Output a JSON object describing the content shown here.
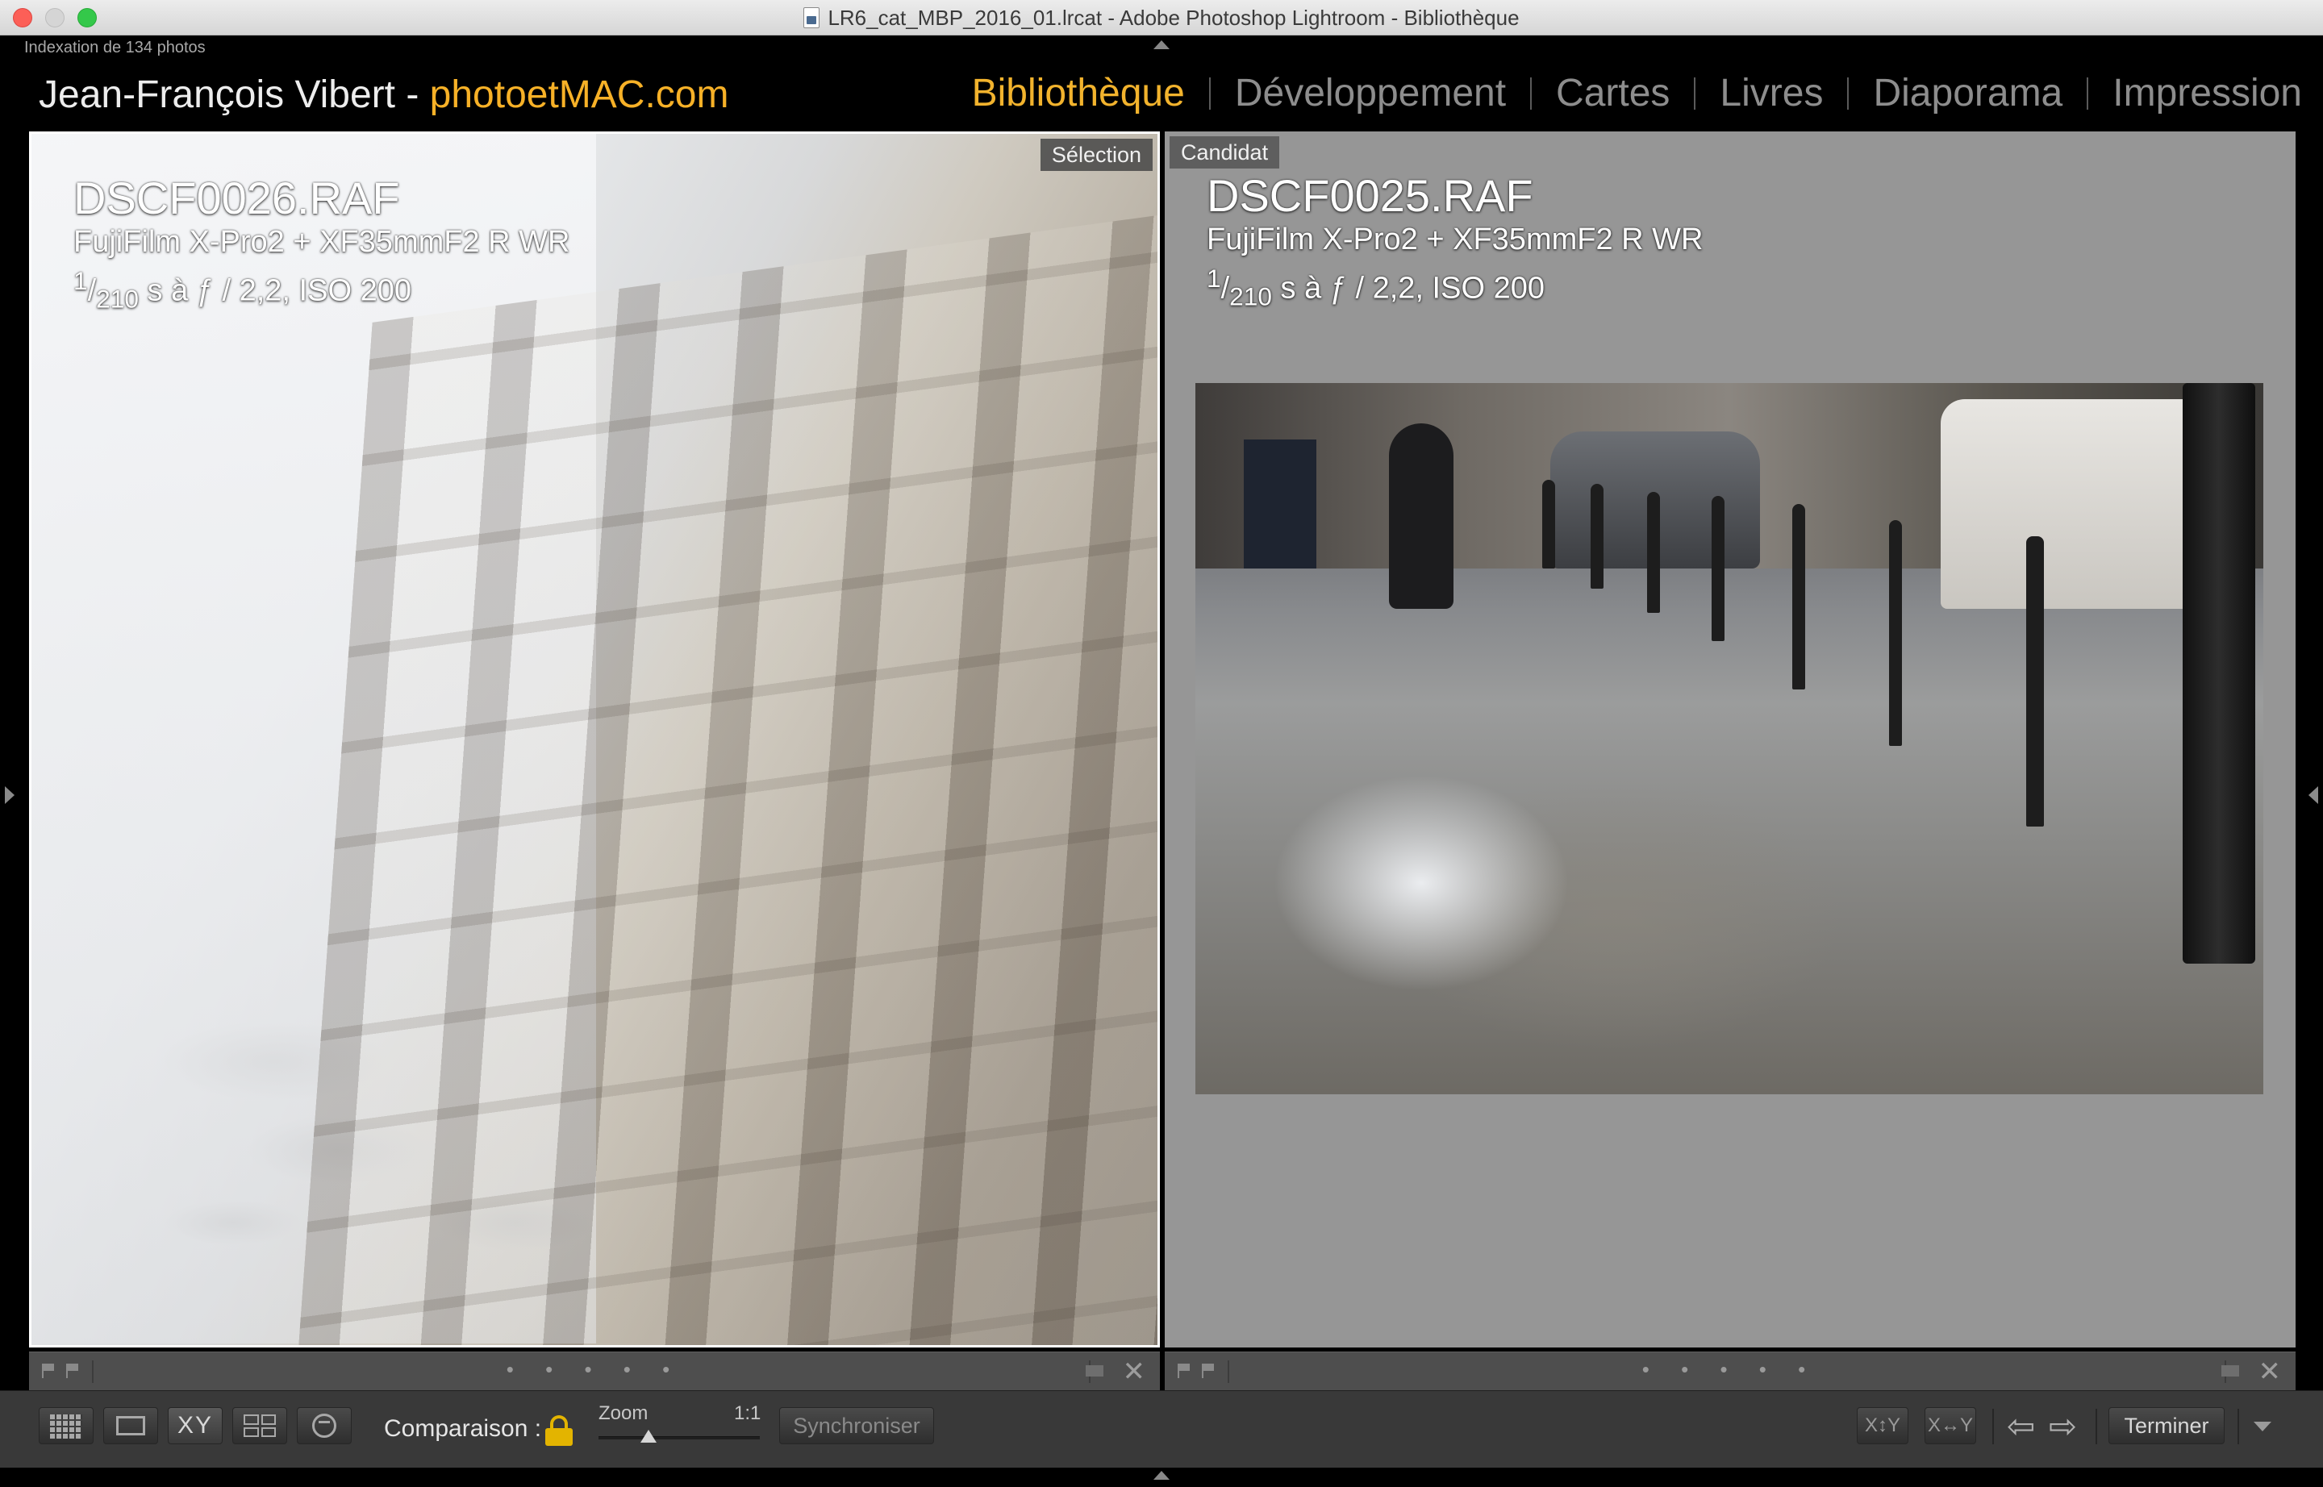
{
  "window": {
    "title": "LR6_cat_MBP_2016_01.lrcat - Adobe Photoshop Lightroom - Bibliothèque"
  },
  "status": {
    "indexing": "Indexation de 134 photos"
  },
  "identity": {
    "name": "Jean-François Vibert - ",
    "site": "photoetMAC.com"
  },
  "modules": [
    {
      "label": "Bibliothèque",
      "active": true
    },
    {
      "label": "Développement",
      "active": false
    },
    {
      "label": "Cartes",
      "active": false
    },
    {
      "label": "Livres",
      "active": false
    },
    {
      "label": "Diaporama",
      "active": false
    },
    {
      "label": "Impression",
      "active": false
    }
  ],
  "compare": {
    "select": {
      "tag": "Sélection",
      "filename": "DSCF0026.RAF",
      "camera": "FujiFilm X-Pro2 + XF35mmF2 R WR",
      "exposure_num": "1",
      "exposure_den": "210",
      "exposure_rest": " s à ƒ / 2,2, ISO 200"
    },
    "candidate": {
      "tag": "Candidat",
      "filename": "DSCF0025.RAF",
      "camera": "FujiFilm X-Pro2 + XF35mmF2 R WR",
      "exposure_num": "1",
      "exposure_den": "210",
      "exposure_rest": " s à ƒ / 2,2, ISO 200"
    },
    "rating_dots": "• • • • •"
  },
  "toolbar": {
    "comparison_label": "Comparaison :",
    "xy_label": "XY",
    "zoom_label": "Zoom",
    "zoom_value": "1:1",
    "zoom_fraction": 0.31,
    "sync_label": "Synchroniser",
    "swap1_label": "X↕Y",
    "swap2_label": "X↔Y",
    "prev_icon": "⇦",
    "next_icon": "⇨",
    "done_label": "Terminer",
    "close_glyph": "✕"
  }
}
